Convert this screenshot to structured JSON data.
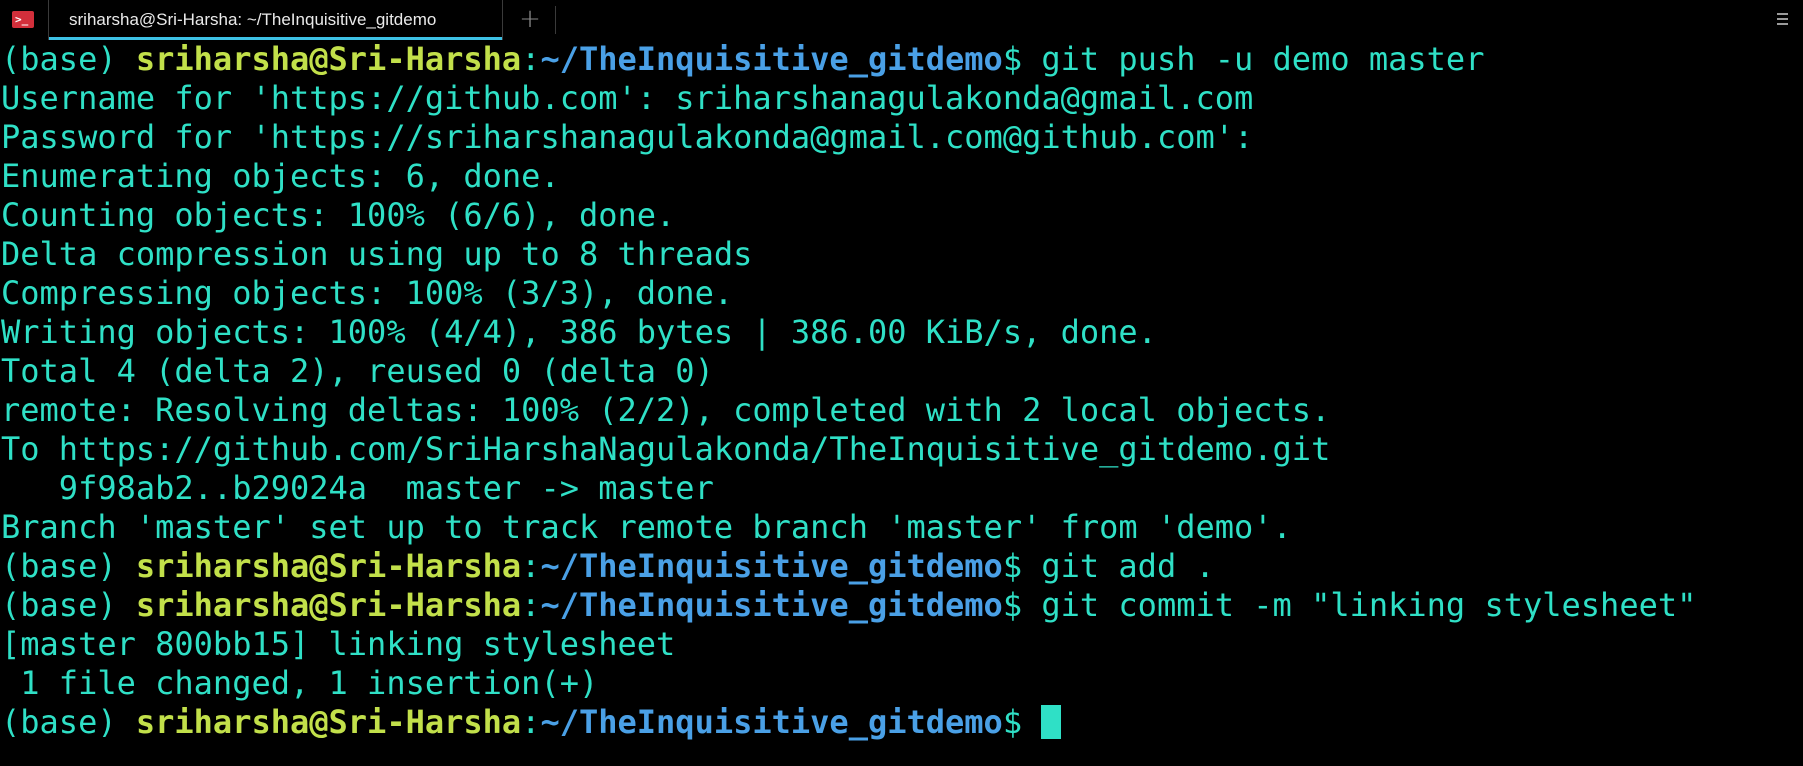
{
  "tab": {
    "title": "sriharsha@Sri-Harsha: ~/TheInquisitive_gitdemo",
    "new_tab_label": "+"
  },
  "colors": {
    "background": "#000000",
    "output_text": "#2fe0c6",
    "prompt_user": "#c2e04a",
    "prompt_path": "#4aa0e6",
    "tab_accent": "#3ec2e6"
  },
  "prompt": {
    "env": "(base) ",
    "user_host": "sriharsha@Sri-Harsha",
    "sep": ":",
    "path": "~/TheInquisitive_gitdemo",
    "dollar": "$ "
  },
  "lines": [
    {
      "type": "prompt",
      "command": "git push -u demo master"
    },
    {
      "type": "output",
      "text": "Username for 'https://github.com': sriharshanagulakonda@gmail.com"
    },
    {
      "type": "output",
      "text": "Password for 'https://sriharshanagulakonda@gmail.com@github.com':"
    },
    {
      "type": "output",
      "text": "Enumerating objects: 6, done."
    },
    {
      "type": "output",
      "text": "Counting objects: 100% (6/6), done."
    },
    {
      "type": "output",
      "text": "Delta compression using up to 8 threads"
    },
    {
      "type": "output",
      "text": "Compressing objects: 100% (3/3), done."
    },
    {
      "type": "output",
      "text": "Writing objects: 100% (4/4), 386 bytes | 386.00 KiB/s, done."
    },
    {
      "type": "output",
      "text": "Total 4 (delta 2), reused 0 (delta 0)"
    },
    {
      "type": "output",
      "text": "remote: Resolving deltas: 100% (2/2), completed with 2 local objects."
    },
    {
      "type": "output",
      "text": "To https://github.com/SriHarshaNagulakonda/TheInquisitive_gitdemo.git"
    },
    {
      "type": "output",
      "text": "   9f98ab2..b29024a  master -> master"
    },
    {
      "type": "output",
      "text": "Branch 'master' set up to track remote branch 'master' from 'demo'."
    },
    {
      "type": "prompt",
      "command": "git add ."
    },
    {
      "type": "prompt",
      "command": "git commit -m \"linking stylesheet\""
    },
    {
      "type": "output",
      "text": "[master 800bb15] linking stylesheet"
    },
    {
      "type": "output",
      "text": " 1 file changed, 1 insertion(+)"
    },
    {
      "type": "prompt",
      "command": "",
      "cursor": true
    }
  ]
}
